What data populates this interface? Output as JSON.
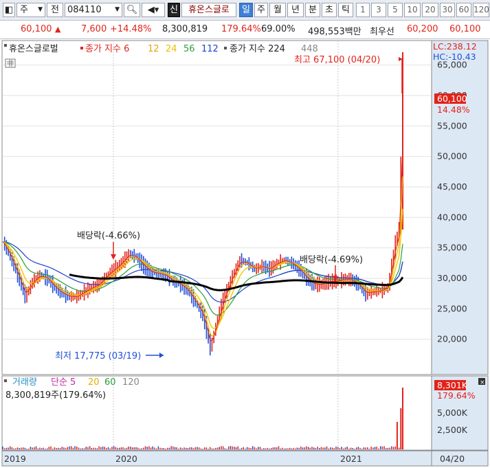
{
  "toolbar": {
    "type_label": "주",
    "prev_label": "전",
    "code_value": "084110",
    "tag_label": "신",
    "stock_name": "휴온스글로",
    "periods": [
      "일",
      "주",
      "월",
      "년",
      "분",
      "초",
      "틱"
    ],
    "intervals": [
      "1",
      "3",
      "5",
      "10",
      "20",
      "30",
      "60",
      "120"
    ]
  },
  "info": {
    "price": "60,100",
    "change": "7,600",
    "change_pct": "+14.48%",
    "volume": "8,300,819",
    "volume_pct": "179.64%",
    "ratio": "69.00%",
    "amount": "498,553백만",
    "bid_label": "최우선",
    "bid1": "60,200",
    "bid2": "60,100"
  },
  "price_panel": {
    "stock_label": "휴온스글로벌",
    "ma_label": "종가 지수 6",
    "ma12": "12",
    "ma24": "24",
    "ma56": "56",
    "ma112": "112",
    "ma224_label": "종가 지수 224",
    "ma448": "448",
    "lc": "LC:238.12",
    "hc": "HC:-10.43",
    "current_tag": "60,100",
    "current_pct": "14.48%",
    "high_note": "최고 67,100 (04/20)",
    "low_note": "최저 17,775 (03/19)",
    "div1": "배당락(-4.66%)",
    "div2": "배당락(-4.69%)",
    "y_ticks": [
      "65,000",
      "60,000",
      "55,000",
      "50,000",
      "45,000",
      "40,000",
      "35,000",
      "30,000",
      "25,000",
      "20,000"
    ]
  },
  "volume_panel": {
    "label": "거래량",
    "ma_label": "단순 5",
    "ma20": "20",
    "ma60": "60",
    "ma120": "120",
    "volume_text": "8,300,819주(179.64%)",
    "tag": "8,301K",
    "tag_pct": "179.64%",
    "y_ticks": [
      "5,000K",
      "2,500K"
    ]
  },
  "x_axis": {
    "labels": [
      "2019",
      "2020",
      "2021"
    ],
    "last": "04/20"
  },
  "colors": {
    "up": "#e2231a",
    "down": "#1f4fd8",
    "ma6": "#e2231a",
    "ma12": "#f2b705",
    "ma24": "#f0c800",
    "ma56": "#2a9d3a",
    "ma112": "#1f3fd0",
    "ma224": "#000000",
    "ma448": "#888888",
    "axis_bg": "#dde8f5"
  },
  "chart_data": {
    "type": "line",
    "title": "",
    "y_range": [
      15000,
      68000
    ],
    "series": [
      {
        "name": "종가",
        "points": [
          [
            0,
            36000
          ],
          [
            4,
            33500
          ],
          [
            8,
            30500
          ],
          [
            12,
            27000
          ],
          [
            16,
            29500
          ],
          [
            20,
            30500
          ],
          [
            24,
            30000
          ],
          [
            28,
            28500
          ],
          [
            32,
            27500
          ],
          [
            36,
            27000
          ],
          [
            40,
            27000
          ],
          [
            44,
            27800
          ],
          [
            48,
            28500
          ],
          [
            52,
            29000
          ],
          [
            56,
            30500
          ],
          [
            60,
            31500
          ],
          [
            64,
            32500
          ],
          [
            68,
            34000
          ],
          [
            72,
            33500
          ],
          [
            76,
            32000
          ],
          [
            80,
            31000
          ],
          [
            84,
            30800
          ],
          [
            88,
            30500
          ],
          [
            92,
            29500
          ],
          [
            96,
            29000
          ],
          [
            100,
            28000
          ],
          [
            104,
            26000
          ],
          [
            108,
            24000
          ],
          [
            112,
            18500
          ],
          [
            116,
            23500
          ],
          [
            120,
            27500
          ],
          [
            124,
            30500
          ],
          [
            128,
            33000
          ],
          [
            132,
            32500
          ],
          [
            136,
            31500
          ],
          [
            140,
            32000
          ],
          [
            144,
            31500
          ],
          [
            148,
            32500
          ],
          [
            152,
            33000
          ],
          [
            156,
            32500
          ],
          [
            160,
            31500
          ],
          [
            164,
            30000
          ],
          [
            168,
            29000
          ],
          [
            172,
            29000
          ],
          [
            176,
            29500
          ],
          [
            180,
            29500
          ],
          [
            184,
            29800
          ],
          [
            188,
            29800
          ],
          [
            192,
            29000
          ],
          [
            196,
            27500
          ],
          [
            200,
            27800
          ],
          [
            204,
            28000
          ],
          [
            208,
            28500
          ],
          [
            212,
            36000
          ],
          [
            214,
            38000
          ],
          [
            216,
            60100
          ]
        ]
      }
    ],
    "annotations": [
      "최고 67,100 (04/20)",
      "최저 17,775 (03/19)",
      "배당락(-4.66%)",
      "배당락(-4.69%)"
    ]
  }
}
